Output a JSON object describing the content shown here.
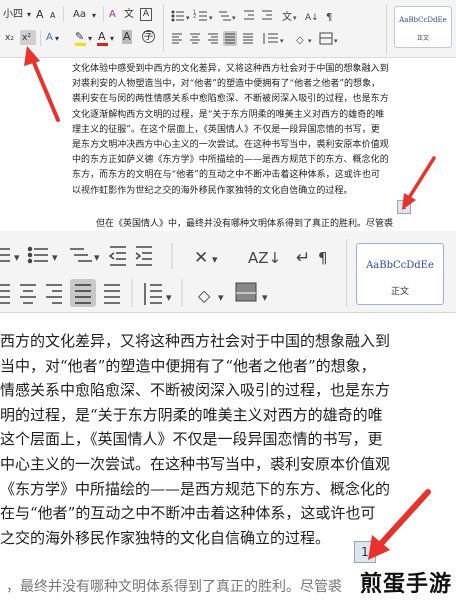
{
  "ribbon_small": {
    "font_size": "小四",
    "font_size_arrow": "▾",
    "grow_font": "A",
    "shrink_font": "A",
    "change_case": "Aa",
    "clear_format": "A",
    "phonetic": "文",
    "subscript": "x₂",
    "superscript": "x²",
    "highlight": "✎",
    "font_color": "A",
    "char_shading": "A",
    "style_card_sample": "AaBbCcDdEe",
    "style_card_name": "正文"
  },
  "ribbon_large": {
    "style_card_sample": "AaBbCcDdEe",
    "style_card_name": "正文"
  },
  "doc_small": {
    "paragraph": [
      "文化体验中感受到中西方的文化差异，又将这种西方社会对于中国的想象融入到",
      "对裘利安的人物塑造当中，对“他者”的塑造中便拥有了“他者之他者”的想象，",
      "裘利安在与闵的两性情感关系中愈陷愈深、不断被闵深入吸引的过程，也是东方",
      "文化逐渐解构西方文明的过程，是“关于东方阴柔的唯美主义对西方的雄奇的唯",
      "理主义的征服”。在这个层面上，《英国情人》不仅是一段异国恋情的书写，更",
      "是东方文明冲决西方中心主义的一次尝试。在这种书写当中，裘利安原本价值观",
      "中的东方正如萨义德《东方学》中所描绘的——是西方规范下的东方、概念化的",
      "东方，而东方的文明在与“他者”的互动之中不断冲击着这种体系，这或许也可",
      "以视作虹影作为世纪之交的海外移民作家独特的文化自信确立的过程。"
    ],
    "cursor_mark": "1",
    "next_line": "但在《英国情人》中，最终并没有哪种文明体系得到了真正的胜利。尽管裘"
  },
  "doc_large": {
    "lines": [
      "西方的文化差异，又将这种西方社会对于中国的想象融入到",
      "当中，对“他者”的塑造中便拥有了“他者之他者”的想象，",
      "情感关系中愈陷愈深、不断被闵深入吸引的过程，也是东方",
      "明的过程，是“关于东方阴柔的唯美主义对西方的雄奇的唯",
      "这个层面上，《英国情人》不仅是一段异国恋情的书写，更",
      "中心主义的一次尝试。在这种书写当中，裘利安原本价值观",
      "《东方学》中所描绘的——是西方规范下的东方、概念化的",
      "在与“他者”的互动之中不断冲击着这种体系，这或许也可",
      "之交的海外移民作家独特的文化自信确立的过程。"
    ],
    "cursor_mark": "1",
    "last_line": "，最终并没有哪种文明体系得到了真正的胜利。尽管裘"
  },
  "watermark": "煎蛋手游",
  "colors": {
    "arrow_red": "#e8322b",
    "highlight_yellow": "#f5e100",
    "font_red": "#d9261c",
    "style_blue": "#2b4aa0"
  }
}
